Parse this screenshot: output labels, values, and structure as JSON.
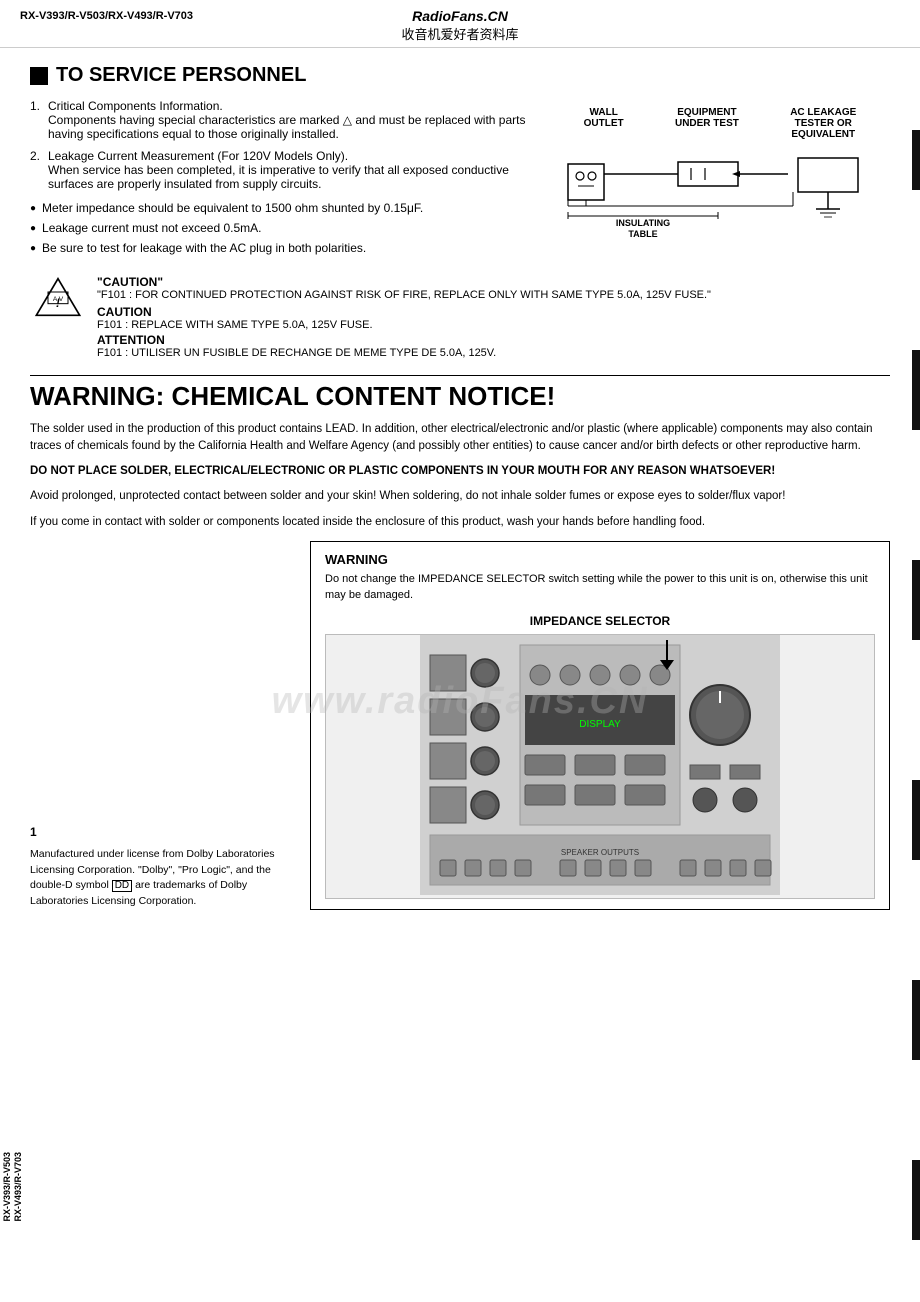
{
  "header": {
    "title": "RadioFans.CN",
    "subtitle": "收音机爱好者资料库",
    "model": "RX-V393/R-V503/RX-V493/R-V703"
  },
  "service_section": {
    "title": "TO SERVICE PERSONNEL",
    "items": [
      {
        "num": "1.",
        "text": "Critical Components Information.\nComponents having special characteristics are marked △ and must be replaced with parts having specifications equal to those originally installed."
      },
      {
        "num": "2.",
        "text": "Leakage Current Measurement (For 120V Models Only).\nWhen service has been completed, it is imperative to verify that all exposed conductive surfaces are properly insulated from supply circuits."
      }
    ],
    "bullets": [
      "Meter impedance should be equivalent to 1500 ohm shunted by 0.15μF.",
      "Leakage current must not exceed 0.5mA.",
      "Be sure to test for leakage with the AC plug in both polarities."
    ]
  },
  "diagram": {
    "labels": [
      "WALL\nOUTLET",
      "EQUIPMENT\nUNDER TEST",
      "AC LEAKAGE\nTESTER OR\nEQUIVALENT"
    ],
    "bottom_label": "INSULATING\nTABLE"
  },
  "caution": {
    "quoted_title": "\"CAUTION\"",
    "quoted_body": "\"F101  : FOR CONTINUED PROTECTION AGAINST RISK OF FIRE, REPLACE ONLY WITH SAME TYPE 5.0A, 125V FUSE.\"",
    "caution_title": "CAUTION",
    "caution_body": "F101   : REPLACE WITH SAME TYPE 5.0A, 125V FUSE.",
    "attention_title": "ATTENTION",
    "attention_body": "F101   : UTILISER UN FUSIBLE DE RECHANGE DE MEME TYPE DE 5.0A, 125V."
  },
  "chemical_notice": {
    "title": "WARNING: CHEMICAL CONTENT NOTICE!",
    "paragraphs": [
      "The solder used in the production of this product contains LEAD. In addition, other electrical/electronic and/or plastic (where applicable) components may also contain traces of chemicals found by the California Health and Welfare Agency (and possibly other entities) to cause cancer and/or birth defects or other reproductive harm.",
      "DO NOT PLACE SOLDER, ELECTRICAL/ELECTRONIC OR PLASTIC COMPONENTS IN YOUR MOUTH FOR ANY REASON WHATSOEVER!",
      "Avoid prolonged, unprotected contact between solder and your skin! When soldering, do not inhale solder fumes or expose eyes to solder/flux vapor!",
      "If you come in contact with solder or components located inside the enclosure of this product, wash your hands before handling food."
    ]
  },
  "warning_impedance": {
    "title": "WARNING",
    "body": "Do not change the IMPEDANCE SELECTOR switch setting while the power to this unit is on, otherwise this unit may be damaged.",
    "selector_label": "IMPEDANCE SELECTOR"
  },
  "dolby": {
    "text": "Manufactured under license from Dolby Laboratories Licensing Corporation. \"Dolby\", \"Pro Logic\", and the double-D symbol   are trademarks of Dolby Laboratories Licensing Corporation."
  },
  "page_num": "1",
  "model_vertical": "RX-V393/R-V503\nRX-V493/R-V703"
}
